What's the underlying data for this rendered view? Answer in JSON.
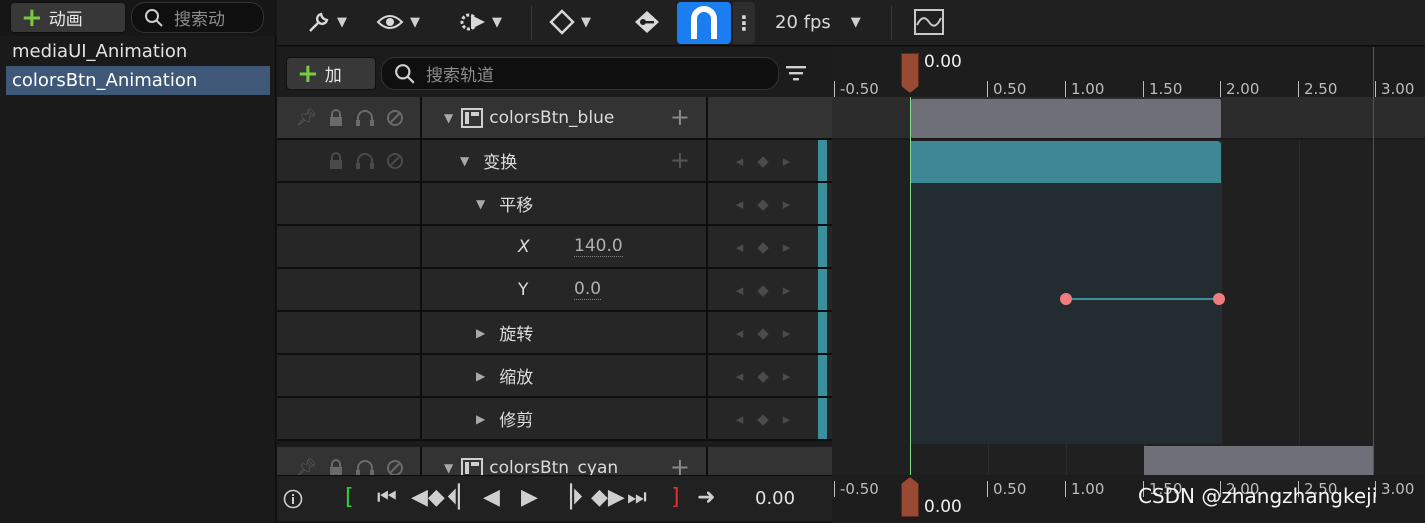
{
  "animation_panel": {
    "add_label": "动画",
    "search_placeholder": "搜索动",
    "items": [
      {
        "label": "mediaUI_Animation"
      },
      {
        "label": "colorsBtn_Animation"
      }
    ]
  },
  "toolbar": {
    "fps_label": "20 fps"
  },
  "track_bar": {
    "add_label": "加",
    "search_placeholder": "搜索轨道"
  },
  "outliner": {
    "rows": [
      {
        "label": "colorsBtn_blue"
      },
      {
        "label": "变换"
      },
      {
        "label": "平移"
      },
      {
        "label": "X",
        "value": "140.0"
      },
      {
        "label": "Y",
        "value": "0.0"
      },
      {
        "label": "旋转"
      },
      {
        "label": "缩放"
      },
      {
        "label": "修剪"
      },
      {
        "label": "colorsBtn_cyan"
      }
    ]
  },
  "transport": {
    "time_value": "0.00"
  },
  "timeline": {
    "current_time": "0.00",
    "ticks": [
      "-0.50",
      "0.50",
      "1.00",
      "1.50",
      "2.00",
      "2.50",
      "3.00"
    ],
    "colors": {
      "selection": "#3f5878",
      "magnet_active": "#1a7df0",
      "section": "#3e8895",
      "key": "#f07d7d",
      "playhead": "#7fdc8a",
      "end_marker": "#a83232"
    }
  },
  "watermark": "CSDN @zhangzhangkeji"
}
